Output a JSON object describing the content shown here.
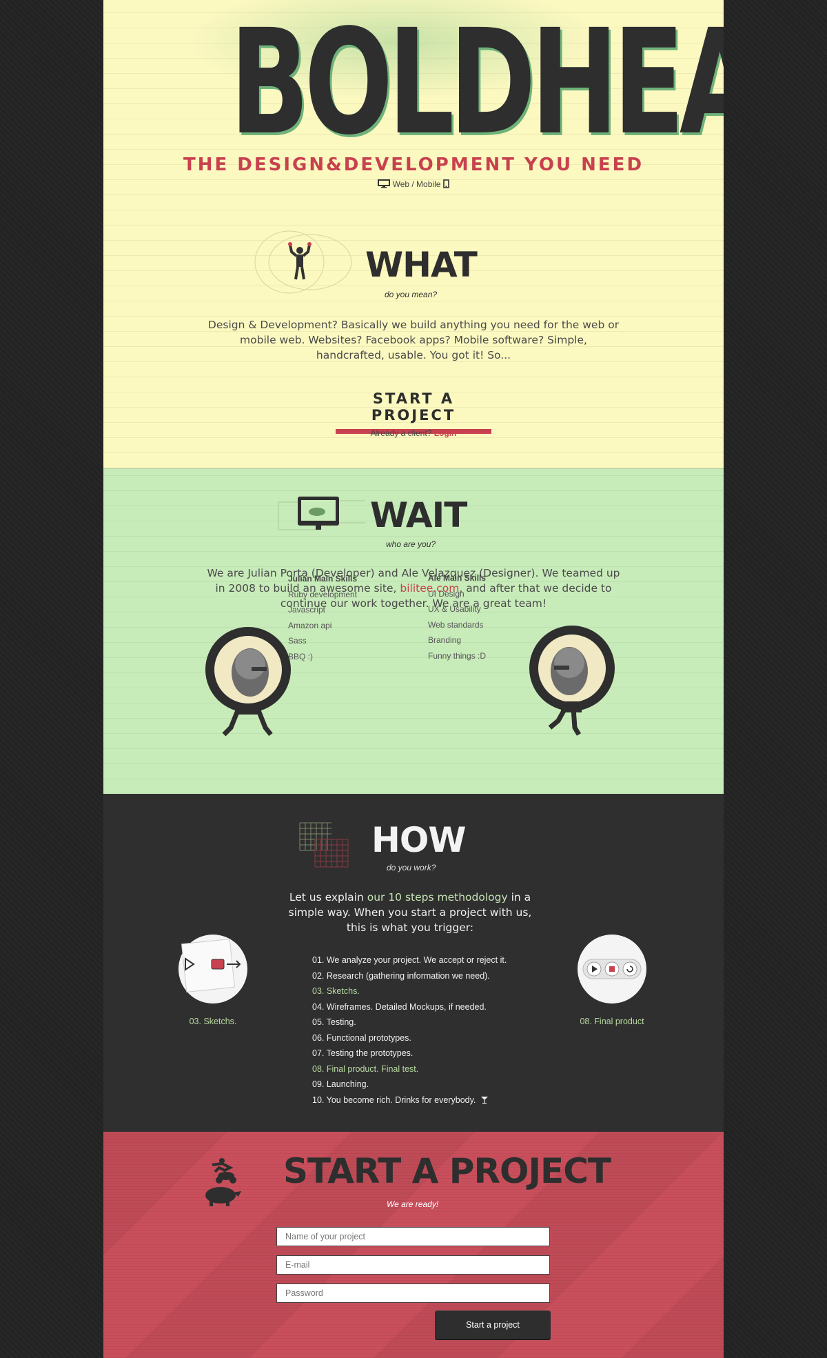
{
  "brand": {
    "logo_text": "BOLDHEADS",
    "tagline": "THE DESIGN&DEVELOPMENT YOU NEED",
    "platforms_text": "Web / Mobile"
  },
  "what": {
    "heading": "WHAT",
    "subheading": "do you mean?",
    "body": "Design & Development? Basically we build anything you need for the web or mobile web. Websites? Facebook apps? Mobile software? Simple, handcrafted, usable. You got it!  So...",
    "cta": "START A PROJECT",
    "client_prompt": "Already a client?",
    "login_label": "Login"
  },
  "wait": {
    "heading": "WAIT",
    "subheading": "who are you?",
    "body_before_link": "We are Julian Porta (Developer) and Ale Velazquez (Designer). We teamed up in 2008 to build an awesome site, ",
    "link_text": "bilitee.com",
    "body_after_link": ", and after that we decide to continue our work together. We are a great team!",
    "julian": {
      "title": "Julian Main Skills",
      "skills": [
        "Ruby development",
        "Javascript",
        "Amazon api",
        "Sass",
        "BBQ :)"
      ]
    },
    "ale": {
      "title": "Ale Main Skills",
      "skills": [
        "UI Design",
        "UX & Usability",
        "Web standards",
        "Branding",
        "Funny things :D"
      ]
    }
  },
  "how": {
    "heading": "HOW",
    "subheading": "do you work?",
    "intro_before": "Let us explain ",
    "intro_link": "our 10 steps methodology",
    "intro_after": " in a simple way. When you start a project with us, this is what you trigger:",
    "steps": [
      "01. We analyze your project. We accept or reject it.",
      "02. Research (gathering information we need).",
      "03. Sketchs.",
      "04. Wireframes. Detailed Mockups, if needed.",
      "05. Testing.",
      "06. Functional prototypes.",
      "07. Testing the prototypes.",
      "08. Final product. Final test.",
      "09. Launching.",
      "10. You become rich. Drinks for everybody."
    ],
    "left_caption": "03. Sketchs.",
    "right_caption": "08. Final product"
  },
  "start": {
    "heading": "START A PROJECT",
    "subheading": "We are ready!",
    "project_placeholder": "Name of your project",
    "email_placeholder": "E-mail",
    "password_placeholder": "Password",
    "submit_label": "Start a project"
  },
  "colors": {
    "accent_red": "#c8414f",
    "highlight_green": "#b8d9a2",
    "dark": "#2e2e2e"
  }
}
